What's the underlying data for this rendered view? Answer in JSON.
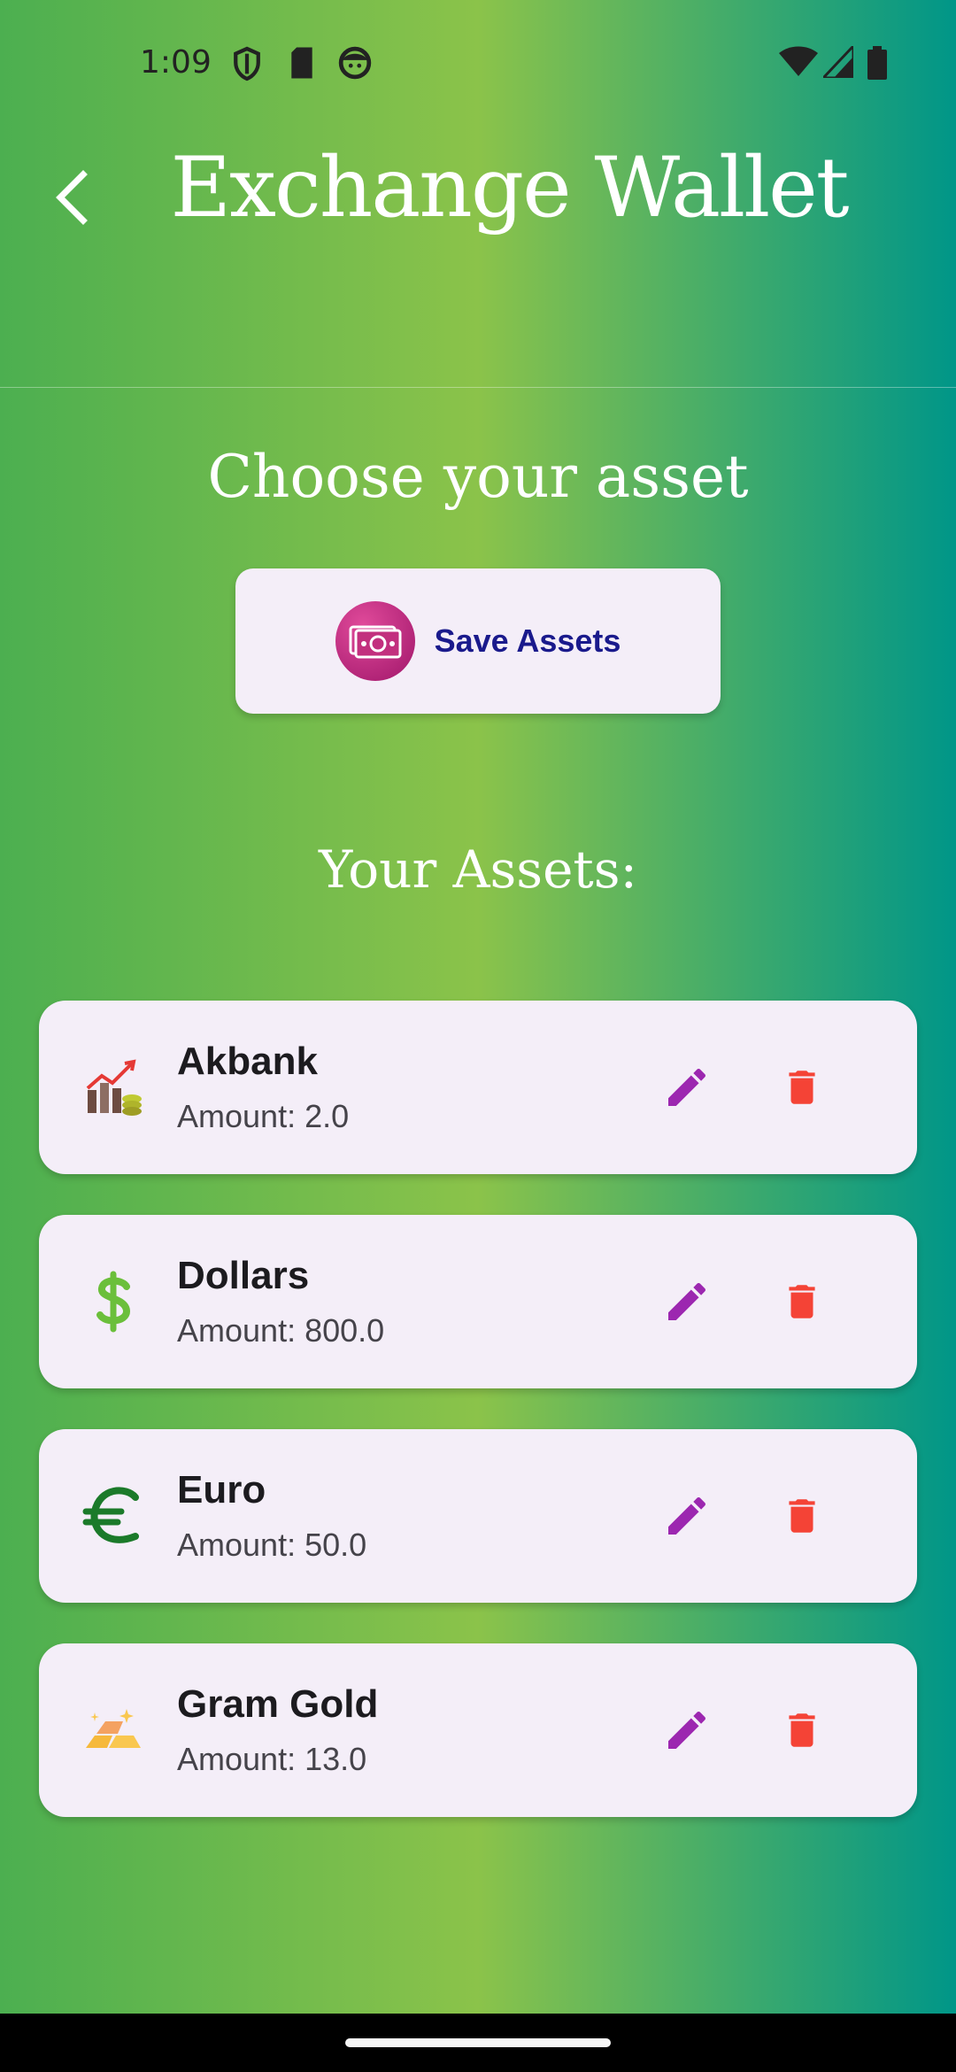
{
  "status_bar": {
    "time": "1:09",
    "icons": [
      "shield-icon",
      "sd-card-icon",
      "face-icon",
      "wifi-icon",
      "signal-icon",
      "battery-icon"
    ]
  },
  "app_bar": {
    "title": "Exchange Wallet",
    "back_icon": "arrow-back-icon"
  },
  "main": {
    "choose_heading": "Choose your asset",
    "save_button": {
      "label": "Save Assets",
      "icon": "money-icon"
    },
    "assets_heading": "Your Assets:",
    "assets": [
      {
        "name": "Akbank",
        "amount": "Amount: 2.0",
        "icon": "stock-chart-icon"
      },
      {
        "name": "Dollars",
        "amount": "Amount: 800.0",
        "icon": "dollar-icon"
      },
      {
        "name": "Euro",
        "amount": "Amount: 50.0",
        "icon": "euro-icon"
      },
      {
        "name": "Gram Gold",
        "amount": "Amount: 13.0",
        "icon": "gold-bars-icon"
      }
    ]
  },
  "colors": {
    "edit": "#9c27b0",
    "delete": "#f44336",
    "card_bg": "#f4eef8",
    "save_label": "#1a1a8c"
  }
}
